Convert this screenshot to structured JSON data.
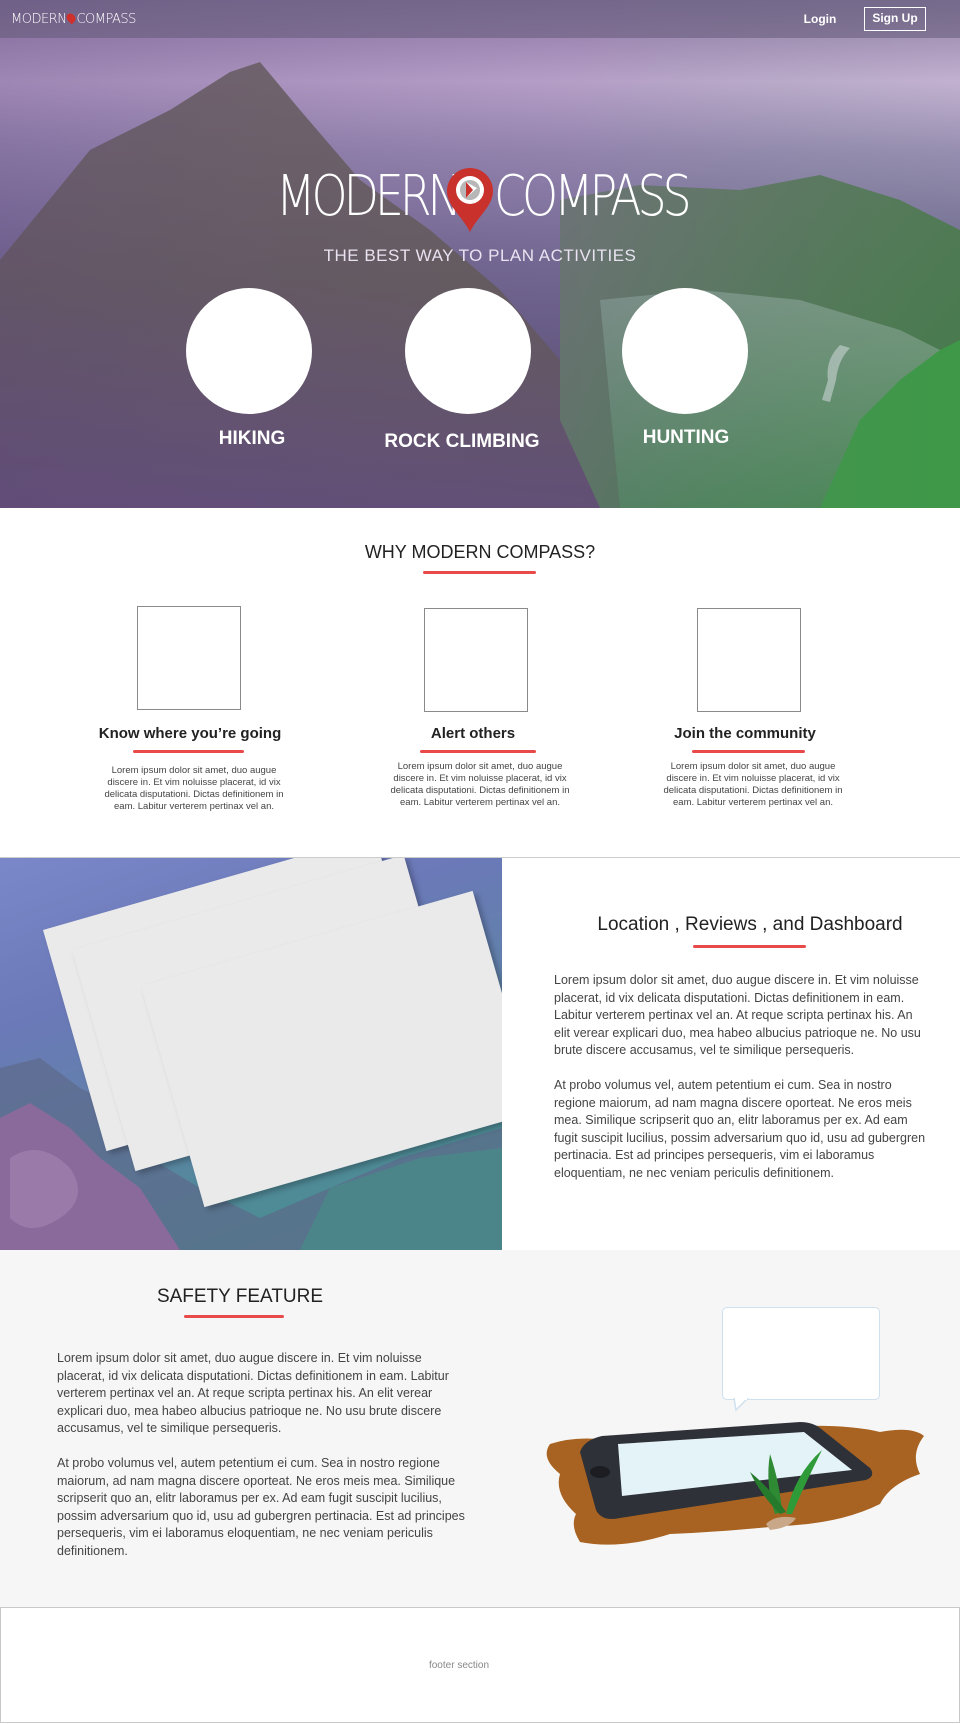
{
  "nav": {
    "logo_left": "MODERN",
    "logo_right": "COMPASS",
    "login": "Login",
    "signup": "Sign Up"
  },
  "hero": {
    "brand_left": "MODERN",
    "brand_right": "COMPASS",
    "tagline": "THE BEST WAY TO PLAN ACTIVITIES",
    "activities": [
      "HIKING",
      "ROCK CLIMBING",
      "HUNTING"
    ]
  },
  "why": {
    "title": "WHY MODERN COMPASS?",
    "features": [
      {
        "title": "Know where you’re going",
        "text": "Lorem ipsum dolor sit amet, duo augue discere in. Et vim noluisse placerat, id vix delicata disputationi. Dictas definitionem in eam. Labitur verterem pertinax vel an."
      },
      {
        "title": "Alert others",
        "text": "Lorem ipsum dolor sit amet, duo augue discere in. Et vim noluisse placerat, id vix delicata disputationi. Dictas definitionem in eam. Labitur verterem pertinax vel an."
      },
      {
        "title": "Join the community",
        "text": "Lorem ipsum dolor sit amet, duo augue discere in. Et vim noluisse placerat, id vix delicata disputationi. Dictas definitionem in eam. Labitur verterem pertinax vel an."
      }
    ]
  },
  "location": {
    "title": "Location , Reviews , and Dashboard",
    "p1": "Lorem ipsum dolor sit amet, duo augue discere in. Et vim noluisse placerat, id vix delicata disputationi. Dictas definitionem in eam. Labitur verterem pertinax vel an. At reque scripta pertinax his. An elit verear explicari duo, mea habeo albucius patrioque ne. No usu brute discere accusamus, vel te similique persequeris.",
    "p2": "At probo volumus vel, autem petentium ei cum. Sea in nostro regione maiorum, ad nam magna discere oporteat. Ne eros meis mea. Similique scripserit quo an, elitr laboramus per ex. Ad eam fugit suscipit lucilius, possim adversarium quo id, usu ad gubergren pertinacia. Est ad principes persequeris, vim ei laboramus eloquentiam, ne nec veniam periculis definitionem."
  },
  "safety": {
    "title": "SAFETY FEATURE",
    "p1": "Lorem ipsum dolor sit amet, duo augue discere in. Et vim noluisse placerat, id vix delicata disputationi. Dictas definitionem in eam. Labitur verterem pertinax vel an. At reque scripta pertinax his. An elit verear explicari duo, mea habeo albucius patrioque ne. No usu brute discere accusamus, vel te similique persequeris.",
    "p2": "At probo volumus vel, autem petentium ei cum. Sea in nostro regione maiorum, ad nam magna discere oporteat. Ne eros meis mea. Similique scripserit quo an, elitr laboramus per ex. Ad eam fugit suscipit lucilius, possim adversarium quo id, usu ad gubergren pertinacia. Est ad principes persequeris, vim ei laboramus eloquentiam, ne nec veniam periculis definitionem."
  },
  "footer": {
    "text": "footer section"
  },
  "colors": {
    "accent_red": "#e84a4a",
    "pin_red": "#c8312c",
    "footer_border": "#c9c9c9"
  }
}
